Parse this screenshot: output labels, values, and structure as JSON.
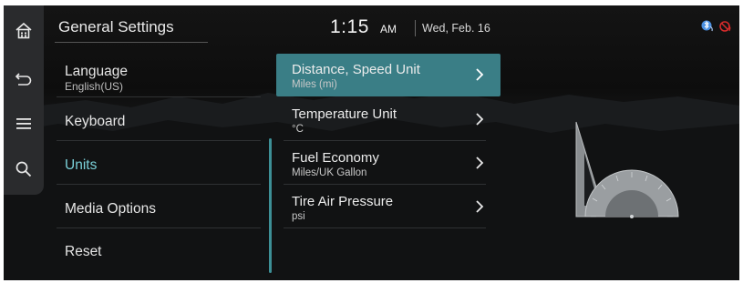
{
  "rail": {
    "buttons": [
      {
        "icon": "home-icon"
      },
      {
        "icon": "back-icon"
      },
      {
        "icon": "menu-icon"
      },
      {
        "icon": "search-icon"
      }
    ]
  },
  "header": {
    "title": "General Settings",
    "time": "1:15",
    "ampm": "AM",
    "date": "Wed, Feb. 16",
    "status_icons": [
      "bluetooth-phone-icon",
      "mute-icon"
    ]
  },
  "menu": {
    "items": [
      {
        "label": "Language",
        "sub": "English(US)"
      },
      {
        "label": "Keyboard"
      },
      {
        "label": "Units",
        "active": true
      },
      {
        "label": "Media Options"
      },
      {
        "label": "Reset"
      }
    ]
  },
  "options": {
    "items": [
      {
        "label": "Distance, Speed Unit",
        "sub": "Miles (mi)",
        "selected": true
      },
      {
        "label": "Temperature Unit",
        "sub": "°C"
      },
      {
        "label": "Fuel Economy",
        "sub": "Miles/UK Gallon"
      },
      {
        "label": "Tire Air Pressure",
        "sub": "psi"
      }
    ]
  },
  "colors": {
    "accent": "#3a7e86",
    "active_text": "#7ad0d8",
    "mute_icon": "#d62b2b",
    "bluetooth_icon": "#4a8fe0"
  },
  "illustration": {
    "icon": "ruler-protractor-icon"
  }
}
